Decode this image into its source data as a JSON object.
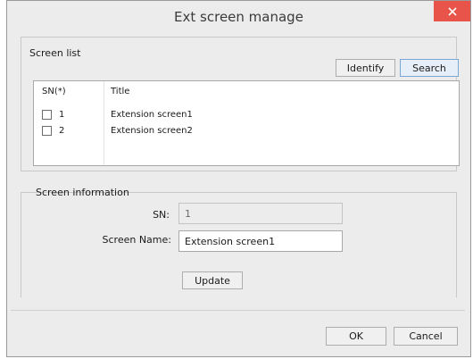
{
  "window": {
    "title": "Ext screen manage"
  },
  "screen_list": {
    "label": "Screen list",
    "identify_label": "Identify",
    "search_label": "Search",
    "columns": [
      "SN(*)",
      "Title"
    ],
    "rows": [
      {
        "sn": "1",
        "title": "Extension screen1",
        "checked": false
      },
      {
        "sn": "2",
        "title": "Extension screen2",
        "checked": false
      }
    ]
  },
  "screen_information": {
    "label": "Screen information",
    "sn_label": "SN:",
    "sn_value": "1",
    "name_label": "Screen Name:",
    "name_value": "Extension screen1",
    "update_label": "Update"
  },
  "footer": {
    "ok_label": "OK",
    "cancel_label": "Cancel"
  },
  "colors": {
    "close_button": "#e8544a",
    "window_bg": "#ececec",
    "selected_button": "#e6eef7"
  }
}
